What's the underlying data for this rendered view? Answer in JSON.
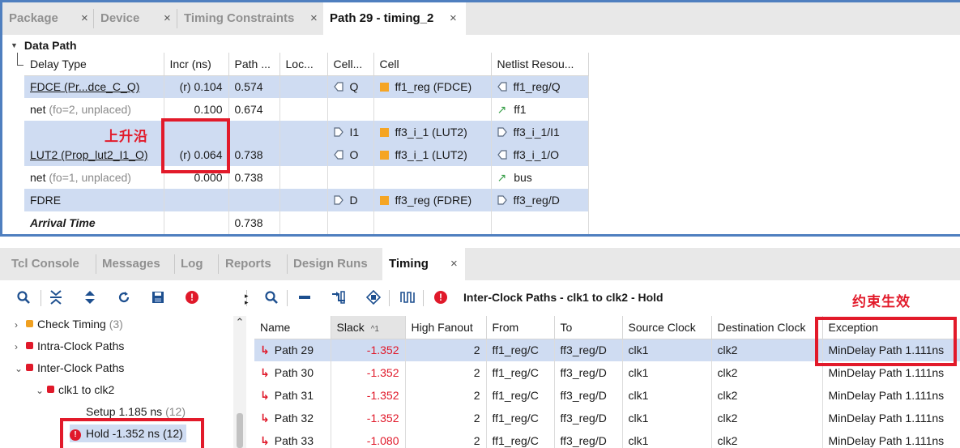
{
  "top_tabs": [
    {
      "label": "Package",
      "active": false
    },
    {
      "label": "Device",
      "active": false
    },
    {
      "label": "Timing Constraints",
      "active": false
    },
    {
      "label": "Path 29 - timing_2",
      "active": true
    }
  ],
  "tab_close_glyph": "×",
  "data_path": {
    "section_title": "Data Path",
    "columns": [
      "Delay Type",
      "Incr (ns)",
      "Path ...",
      "Loc...",
      "Cell...",
      "Cell",
      "Netlist Resou..."
    ],
    "rows": [
      {
        "delay_type": "FDCE (Pr...dce_C_Q)",
        "delay_note": "",
        "incr": "(r) 0.104",
        "path": "0.574",
        "loc": "",
        "cell_pin": "Q",
        "cell": "ff1_reg (FDCE)",
        "netlist": "ff1_reg/Q"
      },
      {
        "delay_type": "net",
        "delay_note": "(fo=2, unplaced)",
        "incr": "0.100",
        "path": "0.674",
        "loc": "",
        "cell_pin": "",
        "cell": "",
        "netlist": "ff1"
      },
      {
        "delay_type": "",
        "delay_note": "",
        "incr": "",
        "path": "",
        "loc": "",
        "cell_pin": "I1",
        "cell": "ff3_i_1 (LUT2)",
        "netlist": "ff3_i_1/I1"
      },
      {
        "delay_type": "LUT2 (Prop_lut2_I1_O)",
        "delay_note": "",
        "incr": "(r) 0.064",
        "path": "0.738",
        "loc": "",
        "cell_pin": "O",
        "cell": "ff3_i_1 (LUT2)",
        "netlist": "ff3_i_1/O"
      },
      {
        "delay_type": "net",
        "delay_note": "(fo=1, unplaced)",
        "incr": "0.000",
        "path": "0.738",
        "loc": "",
        "cell_pin": "",
        "cell": "",
        "netlist": "bus"
      },
      {
        "delay_type": "FDRE",
        "delay_note": "",
        "incr": "",
        "path": "",
        "loc": "",
        "cell_pin": "D",
        "cell": "ff3_reg (FDRE)",
        "netlist": "ff3_reg/D"
      },
      {
        "delay_type": "Arrival Time",
        "delay_note": "",
        "incr": "",
        "path": "0.738",
        "loc": "",
        "cell_pin": "",
        "cell": "",
        "netlist": ""
      }
    ],
    "annotation_rising_edge": "上升沿"
  },
  "bottom_tabs": [
    {
      "label": "Tcl Console",
      "active": false
    },
    {
      "label": "Messages",
      "active": false
    },
    {
      "label": "Log",
      "active": false
    },
    {
      "label": "Reports",
      "active": false
    },
    {
      "label": "Design Runs",
      "active": false
    },
    {
      "label": "Timing",
      "active": true
    }
  ],
  "toolbar_right_title": "Inter-Clock Paths - clk1 to clk2 - Hold",
  "annotation_constraint_effective": "约束生效",
  "tree": {
    "check_timing": {
      "label": "Check Timing",
      "count": "(3)"
    },
    "intra_clock": {
      "label": "Intra-Clock Paths"
    },
    "inter_clock": {
      "label": "Inter-Clock Paths"
    },
    "clk_pair": {
      "label": "clk1 to clk2"
    },
    "setup": {
      "label": "Setup 1.185 ns",
      "count": "(12)"
    },
    "hold": {
      "label": "Hold -1.352 ns (12)"
    }
  },
  "paths_table": {
    "columns": [
      "Name",
      "Slack",
      "High Fanout",
      "From",
      "To",
      "Source Clock",
      "Destination Clock",
      "Exception"
    ],
    "sort_indicator": "^1",
    "rows": [
      {
        "name": "Path 29",
        "slack": "-1.352",
        "fanout": "2",
        "from": "ff1_reg/C",
        "to": "ff3_reg/D",
        "src": "clk1",
        "dst": "clk2",
        "exception": "MinDelay Path 1.111ns"
      },
      {
        "name": "Path 30",
        "slack": "-1.352",
        "fanout": "2",
        "from": "ff1_reg/C",
        "to": "ff3_reg/D",
        "src": "clk1",
        "dst": "clk2",
        "exception": "MinDelay Path 1.111ns"
      },
      {
        "name": "Path 31",
        "slack": "-1.352",
        "fanout": "2",
        "from": "ff1_reg/C",
        "to": "ff3_reg/D",
        "src": "clk1",
        "dst": "clk2",
        "exception": "MinDelay Path 1.111ns"
      },
      {
        "name": "Path 32",
        "slack": "-1.352",
        "fanout": "2",
        "from": "ff1_reg/C",
        "to": "ff3_reg/D",
        "src": "clk1",
        "dst": "clk2",
        "exception": "MinDelay Path 1.111ns"
      },
      {
        "name": "Path 33",
        "slack": "-1.080",
        "fanout": "2",
        "from": "ff1_reg/C",
        "to": "ff3_reg/D",
        "src": "clk1",
        "dst": "clk2",
        "exception": "MinDelay Path 1.111ns"
      }
    ]
  },
  "colors": {
    "accent_blue": "#4f7fbf",
    "highlight": "#cfdcf2",
    "annotation_red": "#e21a2a",
    "slack_red": "#e0192a",
    "cell_orange": "#f5a524"
  },
  "icons": {
    "left_toolbar": [
      "search-icon",
      "collapse-all-icon",
      "expand-all-icon",
      "refresh-icon",
      "save-icon",
      "error-icon"
    ],
    "right_toolbar": [
      "search-icon",
      "minus-icon",
      "route-icon",
      "schematic-icon",
      "waveform-icon",
      "error-icon"
    ]
  }
}
